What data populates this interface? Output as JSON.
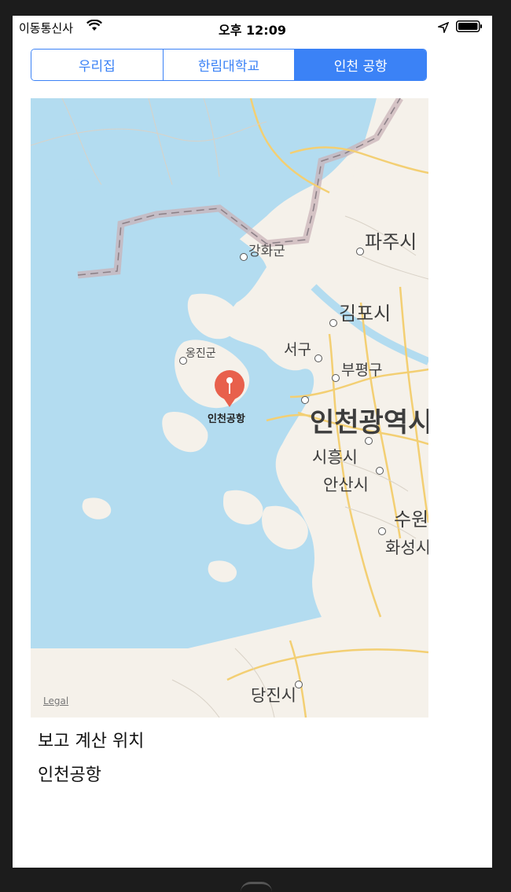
{
  "status_bar": {
    "carrier": "이동통신사",
    "time": "오후 12:09"
  },
  "segments": [
    {
      "label": "우리집",
      "selected": false
    },
    {
      "label": "한림대학교",
      "selected": false
    },
    {
      "label": "인천 공항",
      "selected": true
    }
  ],
  "map": {
    "labels": {
      "ganghwa": "강화군",
      "paju": "파주시",
      "gimpo": "김포시",
      "ongjin": "옹진군",
      "seogu": "서구",
      "bupyeong": "부평구",
      "incheon_city": "인천광역시",
      "siheung": "시흥시",
      "ansan": "안산시",
      "suwon": "수원",
      "hwaseong": "화성시",
      "dangjin": "당진시"
    },
    "pin_label": "인천공항",
    "legal": "Legal"
  },
  "info": {
    "title": "보고 계산 위치",
    "location": "인천공항"
  },
  "colors": {
    "accent": "#3b82f6",
    "water": "#b3dcf0",
    "land": "#f5f1ea",
    "pin": "#e8604c"
  }
}
